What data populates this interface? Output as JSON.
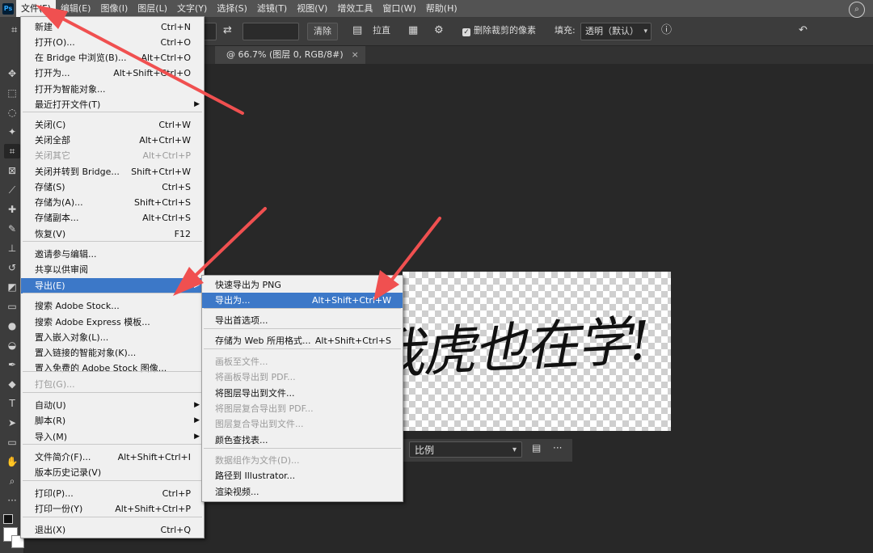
{
  "menubar": {
    "logo": "Ps",
    "items": [
      "文件(F)",
      "编辑(E)",
      "图像(I)",
      "图层(L)",
      "文字(Y)",
      "选择(S)",
      "滤镜(T)",
      "视图(V)",
      "增效工具",
      "窗口(W)",
      "帮助(H)"
    ]
  },
  "options": {
    "clear_label": "清除",
    "straighten_label": "拉直",
    "delete_cropped_label": "删除裁剪的像素",
    "fill_label": "填充:",
    "fill_value": "透明（默认）"
  },
  "document_tab": {
    "title": "@ 66.7% (图层 0, RGB/8#)",
    "close": "×"
  },
  "canvas_text": "我虎也在学!",
  "context_bar": {
    "ratio_label": "比例",
    "more": "···"
  },
  "file_menu": [
    {
      "label": "新建",
      "shortcut": "Ctrl+N"
    },
    {
      "label": "打开(O)...",
      "shortcut": "Ctrl+O"
    },
    {
      "label": "在 Bridge 中浏览(B)...",
      "shortcut": "Alt+Ctrl+O"
    },
    {
      "label": "打开为...",
      "shortcut": "Alt+Shift+Ctrl+O"
    },
    {
      "label": "打开为智能对象...",
      "shortcut": ""
    },
    {
      "label": "最近打开文件(T)",
      "shortcut": ""
    },
    {
      "label": "关闭(C)",
      "shortcut": "Ctrl+W"
    },
    {
      "label": "关闭全部",
      "shortcut": "Alt+Ctrl+W"
    },
    {
      "label": "关闭其它",
      "shortcut": "Alt+Ctrl+P"
    },
    {
      "label": "关闭并转到 Bridge...",
      "shortcut": "Shift+Ctrl+W"
    },
    {
      "label": "存储(S)",
      "shortcut": "Ctrl+S"
    },
    {
      "label": "存储为(A)...",
      "shortcut": "Shift+Ctrl+S"
    },
    {
      "label": "存储副本...",
      "shortcut": "Alt+Ctrl+S"
    },
    {
      "label": "恢复(V)",
      "shortcut": "F12"
    },
    {
      "label": "邀请参与编辑...",
      "shortcut": ""
    },
    {
      "label": "共享以供审阅",
      "shortcut": ""
    },
    {
      "label": "导出(E)",
      "shortcut": ""
    },
    {
      "label": "搜索 Adobe Stock...",
      "shortcut": ""
    },
    {
      "label": "搜索 Adobe Express 模板...",
      "shortcut": ""
    },
    {
      "label": "置入嵌入对象(L)...",
      "shortcut": ""
    },
    {
      "label": "置入链接的智能对象(K)...",
      "shortcut": ""
    },
    {
      "label": "置入免费的 Adobe Stock 图像...",
      "shortcut": ""
    },
    {
      "label": "打包(G)...",
      "shortcut": ""
    },
    {
      "label": "自动(U)",
      "shortcut": ""
    },
    {
      "label": "脚本(R)",
      "shortcut": ""
    },
    {
      "label": "导入(M)",
      "shortcut": ""
    },
    {
      "label": "文件简介(F)...",
      "shortcut": "Alt+Shift+Ctrl+I"
    },
    {
      "label": "版本历史记录(V)",
      "shortcut": ""
    },
    {
      "label": "打印(P)...",
      "shortcut": "Ctrl+P"
    },
    {
      "label": "打印一份(Y)",
      "shortcut": "Alt+Shift+Ctrl+P"
    },
    {
      "label": "退出(X)",
      "shortcut": "Ctrl+Q"
    }
  ],
  "export_menu": [
    {
      "label": "快速导出为 PNG",
      "shortcut": ""
    },
    {
      "label": "导出为...",
      "shortcut": "Alt+Shift+Ctrl+W"
    },
    {
      "label": "导出首选项...",
      "shortcut": ""
    },
    {
      "label": "存储为 Web 所用格式...",
      "shortcut": "Alt+Shift+Ctrl+S"
    },
    {
      "label": "画板至文件...",
      "shortcut": ""
    },
    {
      "label": "将画板导出到 PDF...",
      "shortcut": ""
    },
    {
      "label": "将图层导出到文件...",
      "shortcut": ""
    },
    {
      "label": "将图层复合导出到 PDF...",
      "shortcut": ""
    },
    {
      "label": "图层复合导出到文件...",
      "shortcut": ""
    },
    {
      "label": "颜色查找表...",
      "shortcut": ""
    },
    {
      "label": "数据组作为文件(D)...",
      "shortcut": ""
    },
    {
      "label": "路径到 Illustrator...",
      "shortcut": ""
    },
    {
      "label": "渲染视频...",
      "shortcut": ""
    }
  ],
  "colors": {
    "highlight": "#3c78c8",
    "arrow": "#f05050"
  }
}
